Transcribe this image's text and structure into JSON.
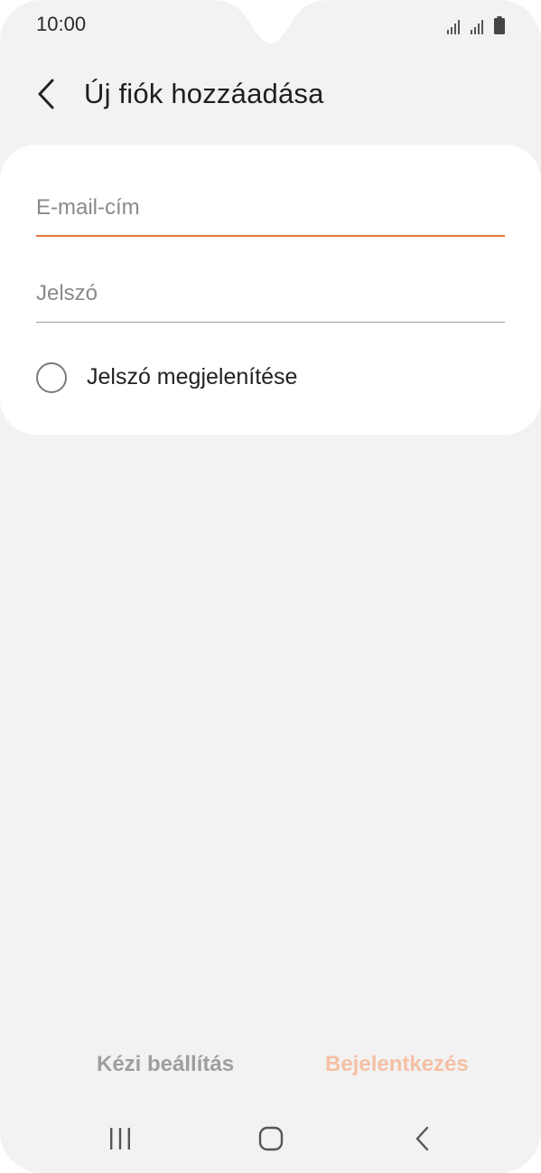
{
  "status_bar": {
    "time": "10:00",
    "signal_icon": "signal-icon",
    "battery_icon": "battery-icon"
  },
  "header": {
    "back_icon": "chevron-left-icon",
    "title": "Új fiók hozzáadása"
  },
  "form": {
    "email": {
      "placeholder": "E-mail-cím",
      "value": ""
    },
    "password": {
      "placeholder": "Jelszó",
      "value": ""
    },
    "show_password": {
      "label": "Jelszó megjelenítése",
      "checked": false
    }
  },
  "actions": {
    "manual_setup": "Kézi beállítás",
    "sign_in": "Bejelentkezés"
  },
  "nav": {
    "recents_icon": "recents-icon",
    "home_icon": "home-icon",
    "back_icon": "back-icon"
  },
  "colors": {
    "accent": "#e8763e",
    "accent_disabled": "#f5c0a5",
    "background": "#f2f2f2",
    "card": "#ffffff"
  }
}
